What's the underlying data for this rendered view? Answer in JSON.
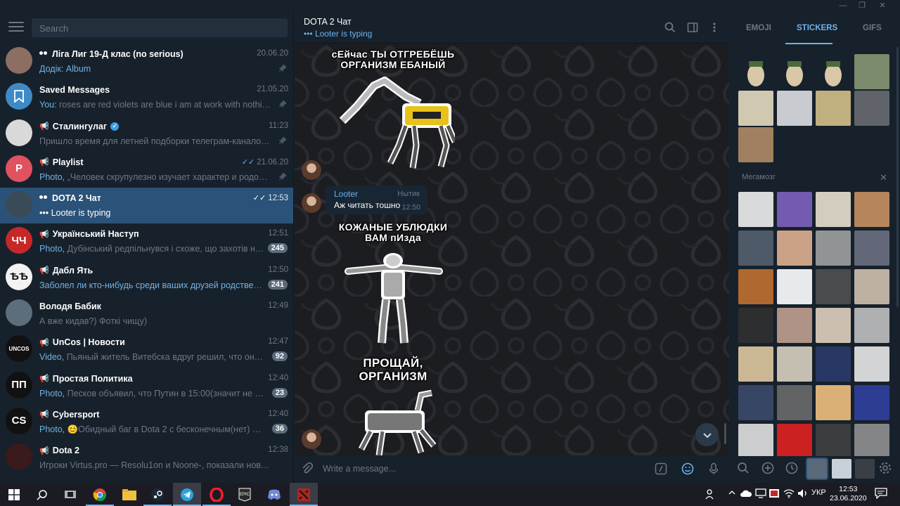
{
  "window": {
    "minimize": "—",
    "maximize": "❐",
    "close": "✕"
  },
  "sidebar": {
    "search_placeholder": "Search",
    "chats": [
      {
        "name": "Ліга Лиг 19-Д клас (no serious)",
        "type": "group",
        "time": "20.06.20",
        "prefix": "Додік:",
        "preview": " Album",
        "preview_hl": true,
        "pinned": true,
        "avatar_color": "#8d6e63",
        "avatar_text": ""
      },
      {
        "name": "Saved Messages",
        "type": "saved",
        "time": "21.05.20",
        "prefix": "You:",
        "preview": " roses are red violets are blue i am at work with nothing to do",
        "pinned": true,
        "avatar_color": "#3d8ac6",
        "avatar_text": ""
      },
      {
        "name": "Сталингулаг",
        "type": "channel",
        "verified": true,
        "time": "11:23",
        "prefix": "",
        "preview": "Пришло время для летней подборки телеграм-каналов: Стро...",
        "pinned": true,
        "avatar_color": "#d9d9d9",
        "avatar_text": ""
      },
      {
        "name": "Playlist",
        "type": "channel",
        "time": "21.06.20",
        "read": true,
        "prefix": "Photo,",
        "preview": " „Человек скрупулезно изучает характер и родословну...",
        "pinned": true,
        "avatar_color": "#e0525f",
        "avatar_text": "P"
      },
      {
        "name": "DOTA 2 Чат",
        "type": "group",
        "time": "12:53",
        "read": true,
        "prefix": "",
        "preview": "••• Looter is typing",
        "active": true,
        "avatar_color": "#3a4a56",
        "avatar_text": ""
      },
      {
        "name": "Український Наступ",
        "type": "channel",
        "time": "12:51",
        "prefix": "Photo,",
        "preview": " Дубінський редпільнувся і схоже, що захотів на тюря...",
        "badge": "245",
        "avatar_color": "#c62828",
        "avatar_text": "ЧЧ"
      },
      {
        "name": "Дабл Ять",
        "type": "channel",
        "time": "12:50",
        "prefix": "",
        "preview": "Заболел ли кто-нибудь среди ваших друзей родственников ...",
        "preview_hl_all": true,
        "badge": "241",
        "avatar_color": "#f2f2f2",
        "avatar_text": "ѢѢ"
      },
      {
        "name": "Володя Бабик",
        "type": "user",
        "time": "12:49",
        "prefix": "",
        "preview": "А вже кидав?) Фоткі чищу)",
        "avatar_color": "#5d6d7a",
        "avatar_text": ""
      },
      {
        "name": "UnCos | Новости",
        "type": "channel",
        "time": "12:47",
        "prefix": "Video,",
        "preview": " Пьяный житель Витебска вдруг решил, что он руфер, и...",
        "badge": "92",
        "avatar_color": "#111111",
        "avatar_text": "UNCOS"
      },
      {
        "name": "Простая Политика",
        "type": "channel",
        "time": "12:40",
        "prefix": "Photo,",
        "preview": " Песков объявил, что Путин в 15:00(значит не раньше ...",
        "badge": "23",
        "avatar_color": "#111111",
        "avatar_text": "ПП"
      },
      {
        "name": "Cybersport",
        "type": "channel",
        "time": "12:40",
        "prefix": "Photo,",
        "preview": " 😊Обидный баг в Dota 2 с бесконечным(нет) золотом:...",
        "badge": "36",
        "avatar_color": "#111111",
        "avatar_text": "CS"
      },
      {
        "name": "Dota 2",
        "type": "channel",
        "time": "12:38",
        "prefix": "",
        "preview": "Игроки Virtus.pro — Resolu1on и Noone-, показали новый буткем...",
        "avatar_color": "#3a1a1a",
        "avatar_text": ""
      }
    ]
  },
  "chat": {
    "title": "DOTA 2 Чат",
    "status": "••• Looter is typing",
    "stickers": [
      {
        "caption": "сЕйчас ТЫ ОТГРЕБЁШЬ ОРГАНИЗМ ЕБАНЫЙ"
      },
      {
        "caption": "КОЖАНЫЕ УБЛЮДКИ ВАМ пИзда"
      },
      {
        "caption": "ПРОЩАЙ, ОРГАНИЗМ"
      }
    ],
    "message": {
      "author": "Looter",
      "role": "Нытик",
      "text": "Аж читать тошно",
      "time": "12:50"
    },
    "composer_placeholder": "Write a message..."
  },
  "emoji_panel": {
    "tabs": [
      "EMOJI",
      "STICKERS",
      "GIFS"
    ],
    "active_tab": "STICKERS",
    "pack_title": "Мегамозг",
    "close": "✕"
  },
  "taskbar": {
    "lang": "УКР",
    "time": "12:53",
    "date": "23.06.2020"
  },
  "colors": {
    "bg": "#17212b",
    "active_chat": "#2b5278",
    "accent": "#6ab3f3",
    "bubble": "#182533"
  }
}
